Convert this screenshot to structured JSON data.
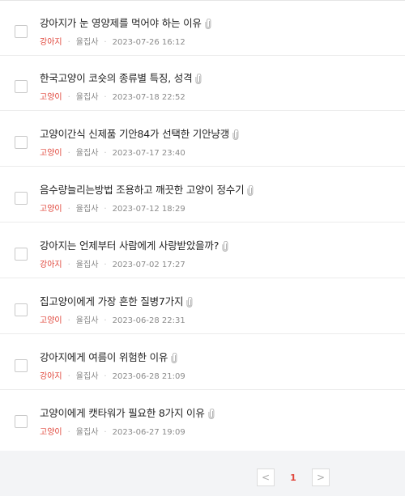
{
  "posts": [
    {
      "title": "강아지가 눈 영양제를 먹어야 하는 이유",
      "category": "강아지",
      "author": "율집사",
      "datetime": "2023-07-26 16:12"
    },
    {
      "title": "한국고양이 코숏의 종류별 특징, 성격",
      "category": "고양이",
      "author": "율집사",
      "datetime": "2023-07-18 22:52"
    },
    {
      "title": "고양이간식 신제품 기안84가 선택한 기안냥갱",
      "category": "고양이",
      "author": "율집사",
      "datetime": "2023-07-17 23:40"
    },
    {
      "title": "음수량늘리는방법 조용하고 깨끗한 고양이 정수기",
      "category": "고양이",
      "author": "율집사",
      "datetime": "2023-07-12 18:29"
    },
    {
      "title": "강아지는 언제부터 사람에게 사랑받았을까?",
      "category": "강아지",
      "author": "율집사",
      "datetime": "2023-07-02 17:27"
    },
    {
      "title": "집고양이에게 가장 흔한 질병7가지",
      "category": "고양이",
      "author": "율집사",
      "datetime": "2023-06-28 22:31"
    },
    {
      "title": "강아지에게 여름이 위험한 이유",
      "category": "강아지",
      "author": "율집사",
      "datetime": "2023-06-28 21:09"
    },
    {
      "title": "고양이에게 캣타워가 필요한 8가지 이유",
      "category": "고양이",
      "author": "율집사",
      "datetime": "2023-06-27 19:09"
    }
  ],
  "pagination": {
    "prev": "<",
    "current": "1",
    "next": ">"
  },
  "colors": {
    "accent": "#e0453a",
    "text": "#222222",
    "meta": "#8a8a8a"
  },
  "icons": {
    "attachment": "paperclip-icon"
  }
}
